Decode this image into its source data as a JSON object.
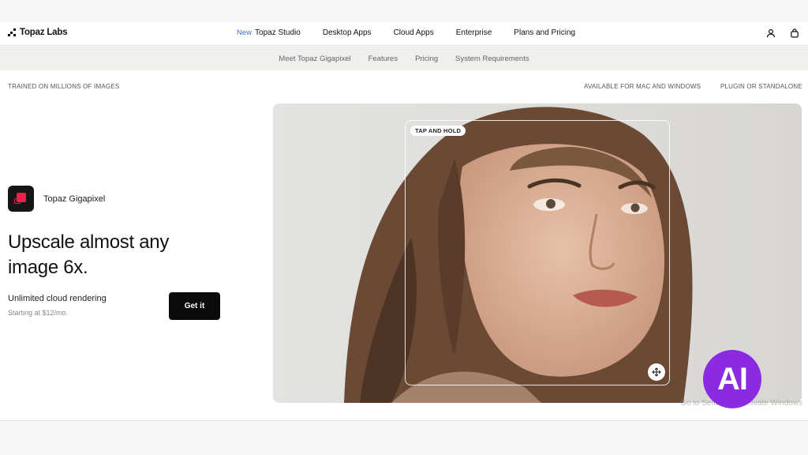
{
  "header": {
    "logo_text": "Topaz Labs",
    "nav": [
      {
        "badge": "New",
        "label": "Topaz Studio"
      },
      {
        "label": "Desktop Apps"
      },
      {
        "label": "Cloud Apps"
      },
      {
        "label": "Enterprise"
      },
      {
        "label": "Plans and Pricing"
      }
    ],
    "icons": [
      "user-icon",
      "shopping-bag-icon"
    ]
  },
  "subnav": {
    "items": [
      "Meet Topaz Gigapixel",
      "Features",
      "Pricing",
      "System Requirements"
    ]
  },
  "labels": {
    "left": "TRAINED ON MILLIONS OF IMAGES",
    "mid": "AVAILABLE FOR MAC AND WINDOWS",
    "right": "PLUGIN OR STANDALONE"
  },
  "product": {
    "name": "Topaz Gigapixel",
    "headline": "Upscale almost any image 6x.",
    "subtitle": "Unlimited cloud rendering",
    "price": "Starting at $12/mo.",
    "cta": "Get it"
  },
  "hero": {
    "pill": "TAP AND HOLD",
    "move_icon": "move-arrows-icon"
  },
  "overlay": {
    "ai_badge": "AI",
    "watermark": "Go to Settings to activate Windows"
  },
  "colors": {
    "accent_new": "#3a6fe0",
    "product_red": "#f0204a",
    "ai_purple": "#8a2be2"
  }
}
